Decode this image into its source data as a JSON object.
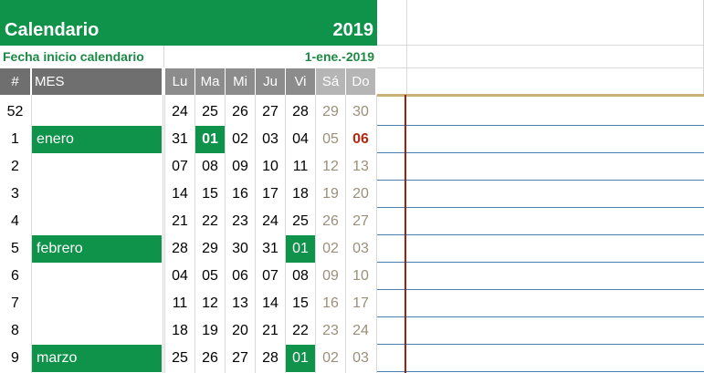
{
  "header": {
    "title": "Calendario",
    "year": "2019"
  },
  "start": {
    "label": "Fecha inicio calendario",
    "value": "1-ene.-2019"
  },
  "columns": {
    "num": "#",
    "mes": "MES",
    "days": [
      "Lu",
      "Ma",
      "Mi",
      "Ju",
      "Vi",
      "Sá",
      "Do"
    ]
  },
  "colors": {
    "accent": "#0f9249",
    "header_gray": "#6f6f6f",
    "weekend_header": "#b5b5b5",
    "holiday_red": "#b22a12",
    "grid_blue": "#4a7fb0"
  },
  "weeks": [
    {
      "num": "52",
      "month": "",
      "days": [
        "24",
        "25",
        "26",
        "27",
        "28",
        "29",
        "30"
      ]
    },
    {
      "num": "1",
      "month": "enero",
      "days": [
        "31",
        "01",
        "02",
        "03",
        "04",
        "05",
        "06"
      ]
    },
    {
      "num": "2",
      "month": "",
      "days": [
        "07",
        "08",
        "09",
        "10",
        "11",
        "12",
        "13"
      ]
    },
    {
      "num": "3",
      "month": "",
      "days": [
        "14",
        "15",
        "16",
        "17",
        "18",
        "19",
        "20"
      ]
    },
    {
      "num": "4",
      "month": "",
      "days": [
        "21",
        "22",
        "23",
        "24",
        "25",
        "26",
        "27"
      ]
    },
    {
      "num": "5",
      "month": "febrero",
      "days": [
        "28",
        "29",
        "30",
        "31",
        "01",
        "02",
        "03"
      ]
    },
    {
      "num": "6",
      "month": "",
      "days": [
        "04",
        "05",
        "06",
        "07",
        "08",
        "09",
        "10"
      ]
    },
    {
      "num": "7",
      "month": "",
      "days": [
        "11",
        "12",
        "13",
        "14",
        "15",
        "16",
        "17"
      ]
    },
    {
      "num": "8",
      "month": "",
      "days": [
        "18",
        "19",
        "20",
        "21",
        "22",
        "23",
        "24"
      ]
    },
    {
      "num": "9",
      "month": "marzo",
      "days": [
        "25",
        "26",
        "27",
        "28",
        "01",
        "02",
        "03"
      ]
    }
  ]
}
